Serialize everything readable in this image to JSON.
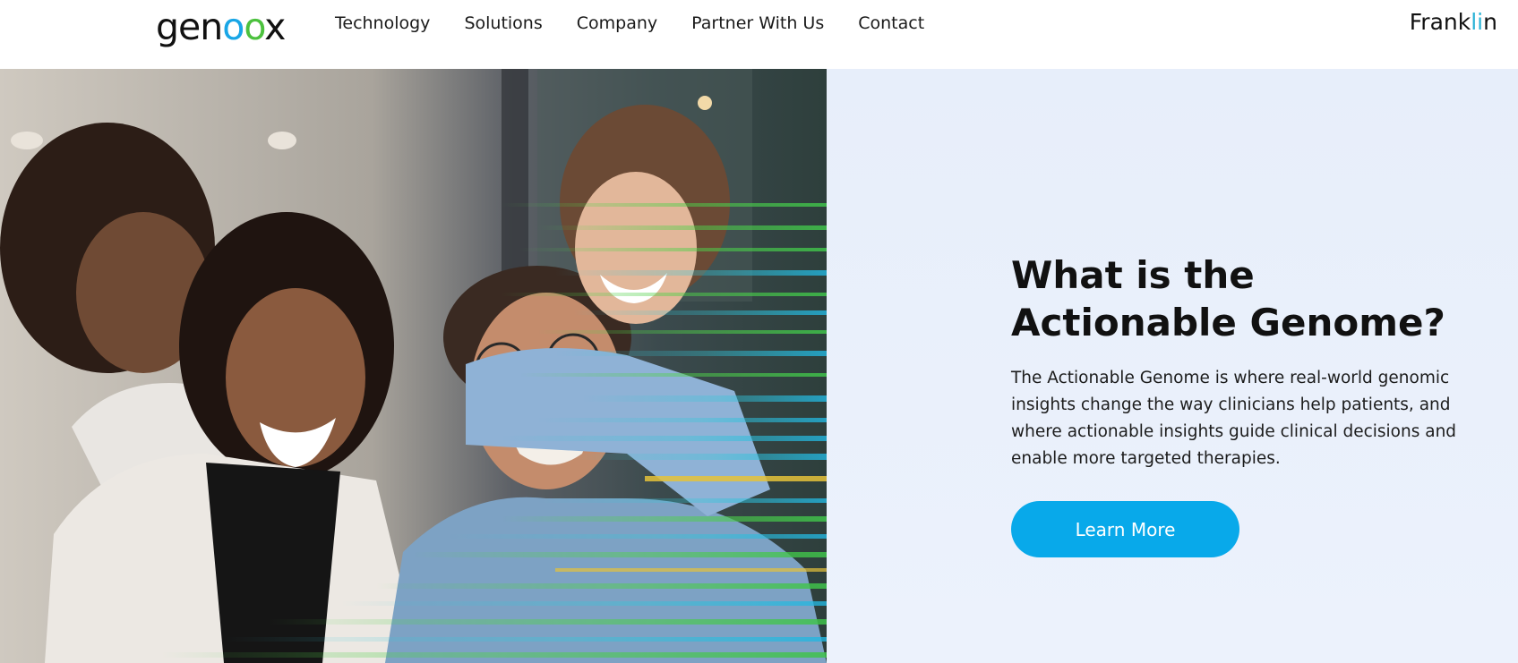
{
  "header": {
    "brand": {
      "prefix": "gen",
      "o1": "o",
      "o2": "o",
      "suffix": "x"
    },
    "nav": [
      "Technology",
      "Solutions",
      "Company",
      "Partner With Us",
      "Contact"
    ],
    "partner_logo": {
      "main": "Frank",
      "accent": "li",
      "end": "n"
    }
  },
  "hero": {
    "title_lines": [
      "What is the",
      "Actionable Genome?"
    ],
    "body_lines": [
      "The Actionable Genome is where real-world genomic",
      "insights change the way clinicians help patients, and",
      "where actionable insights guide clinical decisions and",
      "enable more targeted therapies."
    ],
    "cta_label": "Learn More"
  },
  "colors": {
    "accent": "#08a9ea",
    "panel_bg": "#e9f0fb",
    "brand_blue": "#19a6e6",
    "brand_green": "#4cc13e",
    "stripe_yellow": "#e5c23a"
  }
}
